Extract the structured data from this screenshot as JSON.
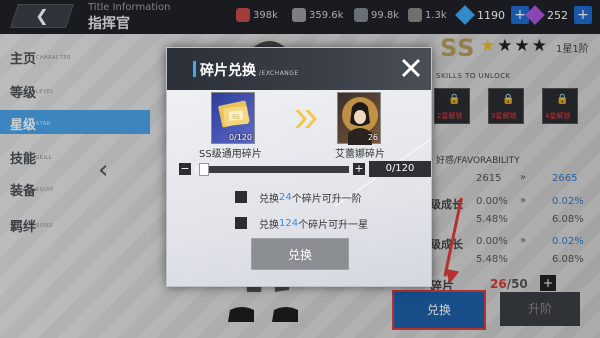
{
  "header": {
    "back_icon": "chevron-left-icon",
    "title_en": "Title Information",
    "title_cn": "指挥官",
    "resources": [
      {
        "value": "398k",
        "color": "#c84a4a"
      },
      {
        "value": "359.6k",
        "color": "#9a9a9a"
      },
      {
        "value": "99.8k",
        "color": "#7f8890"
      },
      {
        "value": "1.3k",
        "color": "#888888"
      }
    ],
    "premium": [
      {
        "value": "1190",
        "color": "#3fa9f5"
      },
      {
        "value": "252",
        "color": "#a855d8"
      }
    ]
  },
  "menu": [
    {
      "cn": "主页",
      "en": "CHARACTER",
      "active": false
    },
    {
      "cn": "等级",
      "en": "LEVEL",
      "active": false
    },
    {
      "cn": "星级",
      "en": "STAR",
      "active": true
    },
    {
      "cn": "技能",
      "en": "SKILL",
      "active": false
    },
    {
      "cn": "装备",
      "en": "EQUIP",
      "active": false
    },
    {
      "cn": "羁绊",
      "en": "BOND",
      "active": false
    }
  ],
  "detail": {
    "rank": "SS",
    "stars_filled": 1,
    "stars_total": 4,
    "stage": "1星1阶",
    "skills_hint": "SKILLS TO UNLOCK",
    "skills": [
      {
        "label": "2星解锁"
      },
      {
        "label": "3星解锁"
      },
      {
        "label": "4星解锁"
      }
    ],
    "favorability_label": "好感/FAVORABILITY",
    "stats": [
      {
        "label": "",
        "from": "2615",
        "to": "2665"
      },
      {
        "label": "级成长",
        "from": "0.00%",
        "to": "0.02%"
      },
      {
        "label": "",
        "from": "5.48%",
        "to": "6.08%"
      },
      {
        "label": "级成长",
        "from": "0.00%",
        "to": "0.02%"
      },
      {
        "label": "",
        "from": "5.48%",
        "to": "6.08%"
      }
    ],
    "fragment_label": "碎片",
    "fragment_have": "26",
    "fragment_need": "/50",
    "exchange_btn": "兑换",
    "upgrade_btn": "升阶"
  },
  "modal": {
    "title": "碎片兑换",
    "subtitle": "/EXCHANGE",
    "close_icon": "close-icon",
    "from_item": {
      "caption": "SS级通用碎片",
      "count": "0/120",
      "card_text": "SS"
    },
    "to_item": {
      "caption": "艾蕾娜碎片",
      "count": "26"
    },
    "slider": {
      "value_text": "0/120",
      "current": 0,
      "max": 120
    },
    "options": [
      {
        "pre": "兑换",
        "num": "24",
        "post": "个碎片可升一阶"
      },
      {
        "pre": "兑换",
        "num": "124",
        "post": "个碎片可升一星"
      }
    ],
    "confirm_label": "兑换"
  }
}
